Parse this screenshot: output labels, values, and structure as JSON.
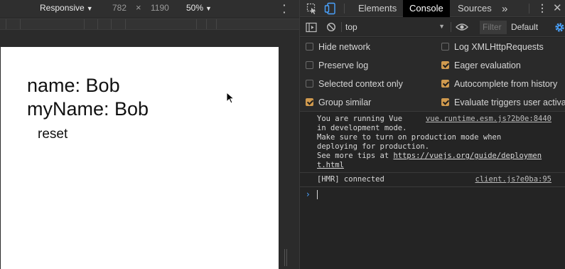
{
  "device_toolbar": {
    "device": "Responsive",
    "width": "782",
    "times": "×",
    "height": "1190",
    "zoom": "50%"
  },
  "page": {
    "name_line": "name: Bob",
    "myname_line": "myName: Bob",
    "reset_label": "reset"
  },
  "devtools": {
    "tabs": {
      "elements": "Elements",
      "console": "Console",
      "sources": "Sources",
      "more": "»"
    },
    "console_toolbar": {
      "context": "top",
      "filter_placeholder": "Filter",
      "levels": "Default"
    },
    "settings": {
      "hide_network": "Hide network",
      "log_xhr": "Log XMLHttpRequests",
      "preserve_log": "Preserve log",
      "eager_eval": "Eager evaluation",
      "selected_context": "Selected context only",
      "autocomplete_history": "Autocomplete from history",
      "group_similar": "Group similar",
      "eval_triggers": "Evaluate triggers user activati"
    },
    "messages": [
      {
        "lines": [
          "You are running Vue",
          "in development mode.",
          "Make sure to turn on production mode when",
          "deploying for production.",
          "See more tips at "
        ],
        "link": "https://vuejs.org/guide/deploymen",
        "link_cont": "t.html",
        "source": "vue.runtime.esm.js?2b0e:8440"
      },
      {
        "text": "[HMR] connected",
        "source": "client.js?e0ba:95"
      }
    ]
  },
  "colors": {
    "checkbox_checked": "#d09a4e",
    "active_tab_bg": "#000000",
    "prompt": "#4aa3ff"
  }
}
